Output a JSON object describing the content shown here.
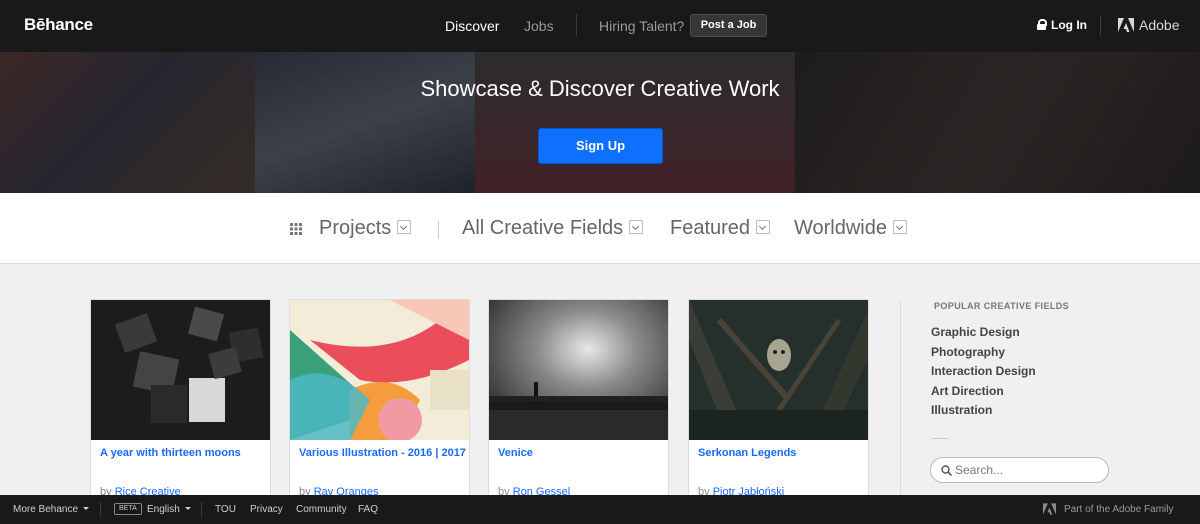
{
  "nav": {
    "logo": "Bēhance",
    "discover": "Discover",
    "jobs": "Jobs",
    "hiring": "Hiring Talent?",
    "post_job": "Post a Job",
    "login": "Log In",
    "adobe": "Adobe"
  },
  "hero": {
    "title": "Showcase & Discover Creative Work",
    "signup": "Sign Up"
  },
  "filters": {
    "projects": "Projects",
    "fields": "All Creative Fields",
    "featured": "Featured",
    "location": "Worldwide"
  },
  "projects": [
    {
      "title": "A year with thirteen moons",
      "by": "by",
      "author": "Rice Creative"
    },
    {
      "title": "Various Illustration - 2016 | 2017",
      "by": "by",
      "author": "Ray Oranges"
    },
    {
      "title": "Venice",
      "by": "by",
      "author": "Ron Gessel"
    },
    {
      "title": "Serkonan Legends",
      "by": "by",
      "author": "Piotr Jabłoński"
    }
  ],
  "sidebar": {
    "heading": "POPULAR CREATIVE FIELDS",
    "items": [
      "Graphic Design",
      "Photography",
      "Interaction Design",
      "Art Direction",
      "Illustration"
    ],
    "search_placeholder": "Search..."
  },
  "footer": {
    "more": "More Behance",
    "beta": "BETA",
    "language": "English",
    "tou": "TOU",
    "privacy": "Privacy",
    "community": "Community",
    "faq": "FAQ",
    "adobe_family": "Part of the Adobe Family"
  },
  "colors": {
    "nav_bg": "#19191b",
    "accent": "#1769ff",
    "signup": "#0f6fff"
  }
}
